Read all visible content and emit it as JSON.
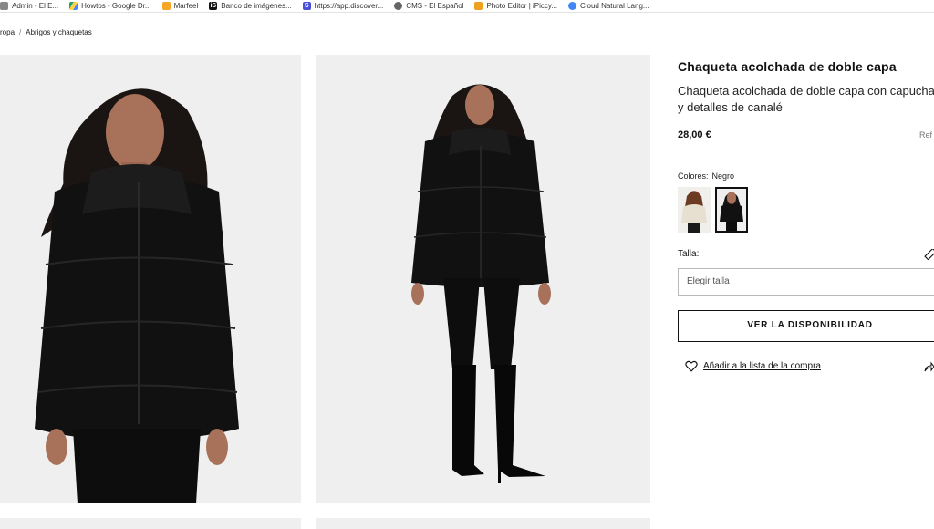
{
  "bookmarks": [
    {
      "label": "Admin - El E...",
      "icon": "admin-icon",
      "color": "#888888"
    },
    {
      "label": "Howtos - Google Dr...",
      "icon": "google-drive-icon",
      "color": "#1fa463"
    },
    {
      "label": "Marfeel",
      "icon": "marfeel-icon",
      "color": "#f5a623"
    },
    {
      "label": "Banco de imágenes...",
      "icon": "istock-icon",
      "color": "#111111"
    },
    {
      "label": "https://app.discover...",
      "icon": "discover-icon",
      "color": "#4b4fd6"
    },
    {
      "label": "CMS - El Español",
      "icon": "globe-icon",
      "color": "#666666"
    },
    {
      "label": "Photo Editor | iPiccy...",
      "icon": "photo-editor-icon",
      "color": "#f0a020"
    },
    {
      "label": "Cloud Natural Lang...",
      "icon": "cloud-icon",
      "color": "#4285f4"
    }
  ],
  "breadcrumb": {
    "items": [
      "ropa",
      "Abrigos y chaquetas"
    ],
    "separator": "/"
  },
  "product": {
    "title": "Chaqueta acolchada de doble capa",
    "description": "Chaqueta acolchada de doble capa con capucha y detalles de canalé",
    "price": "28,00 €",
    "ref": "Ref",
    "colors_label": "Colores:",
    "selected_color": "Negro",
    "size_label": "Talla:",
    "size_placeholder": "Elegir talla",
    "availability_button": "VER LA DISPONIBILIDAD",
    "wishlist_label": "Añadir a la lista de la compra"
  },
  "theme": {
    "text": "#111111",
    "photo_bg": "#efefef",
    "border": "#b9b9b9"
  }
}
